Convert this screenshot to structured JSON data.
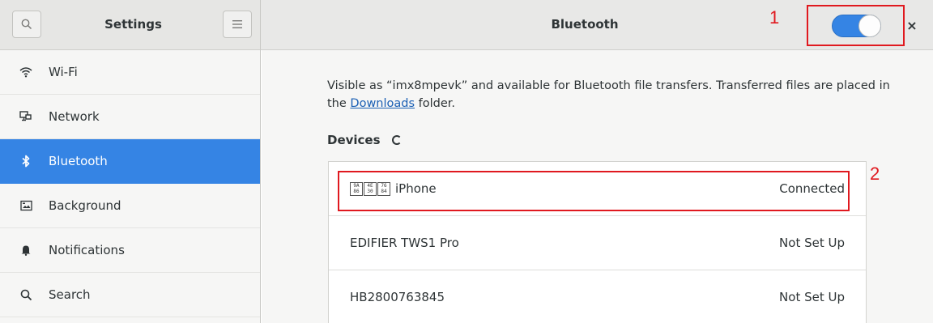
{
  "header": {
    "left_title": "Settings",
    "right_title": "Bluetooth",
    "search_icon": "search-icon",
    "menu_icon": "hamburger-menu-icon",
    "close_glyph": "×",
    "bluetooth_toggle_on": true
  },
  "sidebar": {
    "items": [
      {
        "label": "Wi-Fi",
        "icon": "wifi-icon"
      },
      {
        "label": "Network",
        "icon": "network-icon"
      },
      {
        "label": "Bluetooth",
        "icon": "bluetooth-icon",
        "active": true
      },
      {
        "label": "Background",
        "icon": "background-icon"
      },
      {
        "label": "Notifications",
        "icon": "bell-icon"
      },
      {
        "label": "Search",
        "icon": "search-icon"
      }
    ]
  },
  "content": {
    "desc_before_link": "Visible as “imx8mpevk” and available for Bluetooth file transfers. Transferred files are placed in the ",
    "desc_link": "Downloads",
    "desc_after_link": " folder.",
    "devices_header": "Devices",
    "devices": [
      {
        "name": "iPhone",
        "prefix_glyphs": [
          [
            "9A",
            "86"
          ],
          [
            "4E",
            "30"
          ],
          [
            "76",
            "84"
          ]
        ],
        "status": "Connected"
      },
      {
        "name": "EDIFIER TWS1 Pro",
        "status": "Not Set Up"
      },
      {
        "name": "HB2800763845",
        "status": "Not Set Up"
      }
    ]
  },
  "annotations": [
    {
      "number": "1"
    },
    {
      "number": "2"
    }
  ],
  "colors": {
    "accent": "#3584e4",
    "annotation": "#e0191f",
    "link": "#1a5fb4"
  }
}
